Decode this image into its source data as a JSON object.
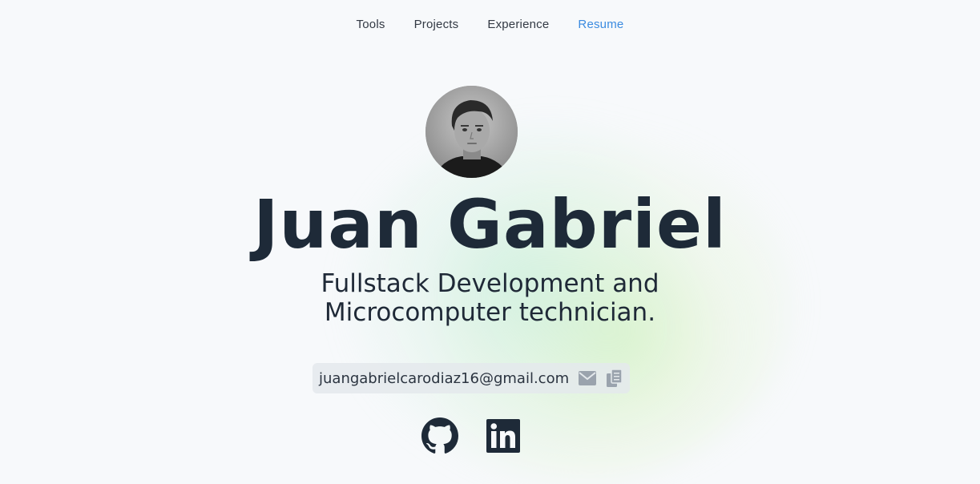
{
  "nav": {
    "items": [
      {
        "label": "Tools"
      },
      {
        "label": "Projects"
      },
      {
        "label": "Experience"
      },
      {
        "label": "Resume"
      }
    ]
  },
  "hero": {
    "name": "Juan Gabriel",
    "subtitle_line1": "Fullstack Development and",
    "subtitle_line2": "Microcomputer technician."
  },
  "contact": {
    "email": "juangabrielcarodiaz16@gmail.com",
    "email_icon": "envelope-icon",
    "copy_icon": "copy-icon"
  },
  "socials": [
    {
      "icon": "github-icon"
    },
    {
      "icon": "linkedin-icon"
    }
  ],
  "colors": {
    "background": "#f7f9fb",
    "text": "#1e2a38",
    "accent": "#3b8be0",
    "icon_muted": "#9aa3ad"
  }
}
